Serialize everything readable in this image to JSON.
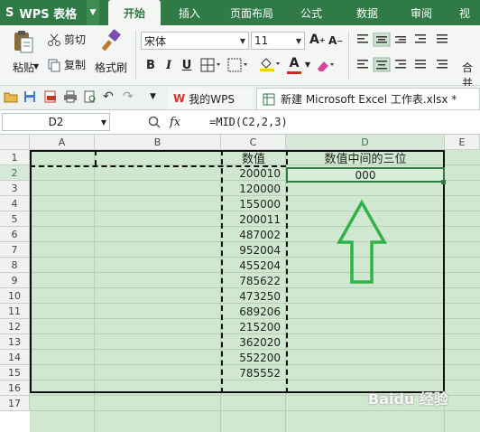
{
  "app": {
    "logo": "S",
    "name": "WPS 表格"
  },
  "menu_tabs": [
    "开始",
    "插入",
    "页面布局",
    "公式",
    "数据",
    "审阅",
    "视"
  ],
  "ribbon": {
    "paste_label": "粘贴",
    "cut_label": "剪切",
    "copy_label": "复制",
    "format_painter_label": "格式刷",
    "font_name": "宋体",
    "font_size": "11",
    "bold": "B",
    "italic": "I",
    "underline": "U",
    "font_color_letter": "A",
    "grow_font": "A",
    "shrink_font": "A",
    "merge_label": "合并"
  },
  "doc_tabs": [
    {
      "label": "我的WPS"
    },
    {
      "label": "新建 Microsoft Excel 工作表.xlsx *"
    }
  ],
  "formula_bar": {
    "name_box": "D2",
    "fx": "fx",
    "formula": "=MID(C2,2,3)"
  },
  "sheet": {
    "columns": [
      "A",
      "B",
      "C",
      "D",
      "E"
    ],
    "rows": [
      "1",
      "2",
      "3",
      "4",
      "5",
      "6",
      "7",
      "8",
      "9",
      "10",
      "11",
      "12",
      "13",
      "14",
      "15",
      "16",
      "17"
    ],
    "c1_header": "数值",
    "d1_header": "数值中间的三位",
    "d2_value": "000",
    "c_values": [
      "200010",
      "120000",
      "155000",
      "200011",
      "487002",
      "952004",
      "455204",
      "785622",
      "473250",
      "689206",
      "215200",
      "362020",
      "552200",
      "785552"
    ]
  },
  "watermark": "Baidu 经验",
  "colors": {
    "accent": "#2f7a45",
    "cell_fill": "#cfe8cf",
    "arrow": "#2fb24a"
  }
}
